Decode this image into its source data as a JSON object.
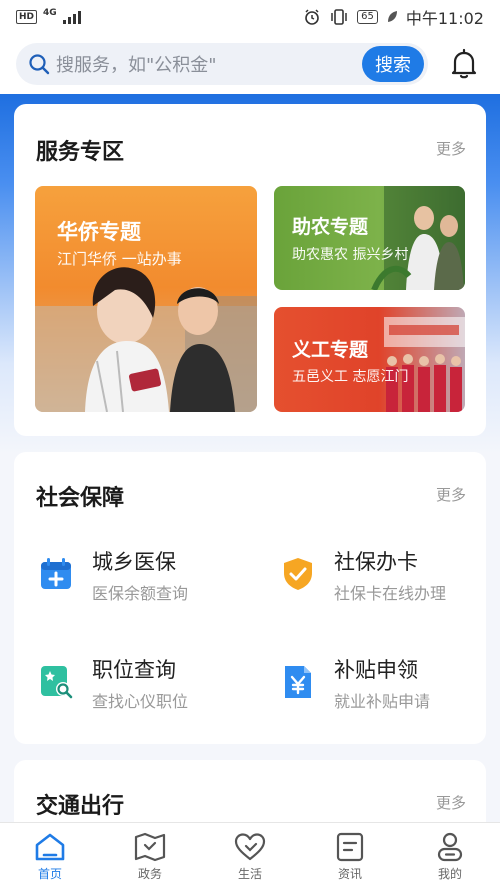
{
  "status_bar": {
    "hd": "HD",
    "network": "4G",
    "battery": "65",
    "time": "中午11:02"
  },
  "search": {
    "placeholder": "搜服务，如\"公积金\"",
    "button": "搜索"
  },
  "service_zone": {
    "title": "服务专区",
    "more": "更多",
    "banners": [
      {
        "title": "华侨专题",
        "subtitle": "江门华侨  一站办事"
      },
      {
        "title": "助农专题",
        "subtitle": "助农惠农  振兴乡村"
      },
      {
        "title": "义工专题",
        "subtitle": "五邑义工  志愿江门"
      }
    ]
  },
  "social_security": {
    "title": "社会保障",
    "more": "更多",
    "items": [
      {
        "name": "城乡医保",
        "desc": "医保余额查询",
        "icon": "medical-calendar-icon",
        "color": "#2f8cf0"
      },
      {
        "name": "社保办卡",
        "desc": "社保卡在线办理",
        "icon": "shield-check-icon",
        "color": "#f6a623"
      },
      {
        "name": "职位查询",
        "desc": "查找心仪职位",
        "icon": "job-search-icon",
        "color": "#2fc0a0"
      },
      {
        "name": "补贴申领",
        "desc": "就业补贴申请",
        "icon": "yuan-document-icon",
        "color": "#2f8cf0"
      }
    ]
  },
  "transport": {
    "title": "交通出行",
    "more": "更多"
  },
  "tabbar": {
    "tabs": [
      {
        "label": "首页",
        "icon": "home-icon",
        "active": true
      },
      {
        "label": "政务",
        "icon": "map-icon",
        "active": false
      },
      {
        "label": "生活",
        "icon": "heart-icon",
        "active": false
      },
      {
        "label": "资讯",
        "icon": "news-icon",
        "active": false
      },
      {
        "label": "我的",
        "icon": "profile-icon",
        "active": false
      }
    ]
  },
  "colors": {
    "accent": "#1f7be6",
    "active_tab": "#1f7be6"
  }
}
